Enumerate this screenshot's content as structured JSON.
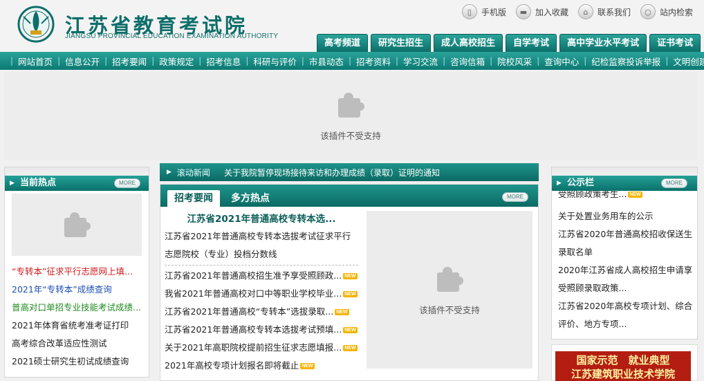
{
  "header": {
    "title": "江苏省教育考试院",
    "subtitle": "JIANGSU PROVINCIAL EDUCATION EXAMINATION AUTHORITY",
    "top_links": [
      {
        "label": "手机版",
        "icon": "phone-icon"
      },
      {
        "label": "加入收藏",
        "icon": "bookmark-icon"
      },
      {
        "label": "联系我们",
        "icon": "home-icon"
      },
      {
        "label": "站内检索",
        "icon": "search-icon"
      }
    ],
    "channel_tabs": [
      "高考频道",
      "研究生招生",
      "成人高校招生",
      "自学考试",
      "高中学业水平考试",
      "证书考试"
    ]
  },
  "nav": [
    "网站首页",
    "信息公开",
    "招考要闻",
    "政策规定",
    "招考信息",
    "科研与评价",
    "市县动态",
    "招考资料",
    "学习交流",
    "咨询信箱",
    "院校风采",
    "查询中心",
    "纪检监察投诉举报",
    "文明创建"
  ],
  "banner": {
    "plugin_text": "该插件不受支持"
  },
  "hot": {
    "title": "当前热点",
    "more": "MORE",
    "items": [
      {
        "text": "“专转本”征求平行志愿网上填...",
        "color": "#cc1a1a"
      },
      {
        "text": "2021年“专转本”成绩查询",
        "color": "#1a4fb0"
      },
      {
        "text": "普高对口单招专业技能考试成绩...",
        "color": "#1f8a1f"
      },
      {
        "text": "2021年体育省统考准考证打印",
        "color": "#222222"
      },
      {
        "text": "高考综合改革适应性测试",
        "color": "#222222"
      },
      {
        "text": "2021硕士研究生初试成绩查询",
        "color": "#222222"
      }
    ]
  },
  "ticker": {
    "label": "滚动新闻",
    "message": "关于我院暂停现场接待来访和办理成绩（录取）证明的通知"
  },
  "main": {
    "tabs": [
      "招考要闻",
      "多方热点"
    ],
    "more": "MORE",
    "headline": "江苏省2021年普通高校专转本选...",
    "lead": "江苏省2021年普通高校专转本选拔考试征求平行志愿院校（专业）投档分数线",
    "items": [
      {
        "text": "江苏省2021年普通高校招生准予享受照顾政...",
        "new": true
      },
      {
        "text": "我省2021年普通高校对口中等职业学校毕业...",
        "new": true
      },
      {
        "text": "江苏省2021年普通高校“专转本”选拔录取...",
        "new": true
      },
      {
        "text": "江苏省2021年普通高校专转本选拔考试预填...",
        "new": true
      },
      {
        "text": "关于2021年高职院校提前招生征求志愿填报...",
        "new": true
      },
      {
        "text": "2021年高校专项计划报名即将截止",
        "new": true
      }
    ],
    "new_badge": "NEW",
    "plugin_text": "该插件不受支持"
  },
  "notice": {
    "title": "公示栏",
    "more": "MORE",
    "items": [
      {
        "text": "受照顾政策考生...",
        "new": true
      },
      {
        "text": "关于处置业务用车的公示",
        "new": false
      },
      {
        "text": "江苏省2020年普通高校招收保送生",
        "new": false
      },
      {
        "text": "录取名单",
        "new": false
      },
      {
        "text": "2020年江苏省成人高校招生申请享",
        "new": false
      },
      {
        "text": "受照顾录取政策...",
        "new": false
      },
      {
        "text": "江苏省2020年高校专项计划、综合",
        "new": false
      },
      {
        "text": "评价、地方专项...",
        "new": false
      }
    ]
  },
  "promo": {
    "line1": "国家示范　就业典型",
    "line2": "江苏建筑职业技术学院"
  },
  "colors": {
    "teal": "#0b6f69",
    "accent_red": "#b31d12",
    "new_badge": "#f5b400"
  }
}
